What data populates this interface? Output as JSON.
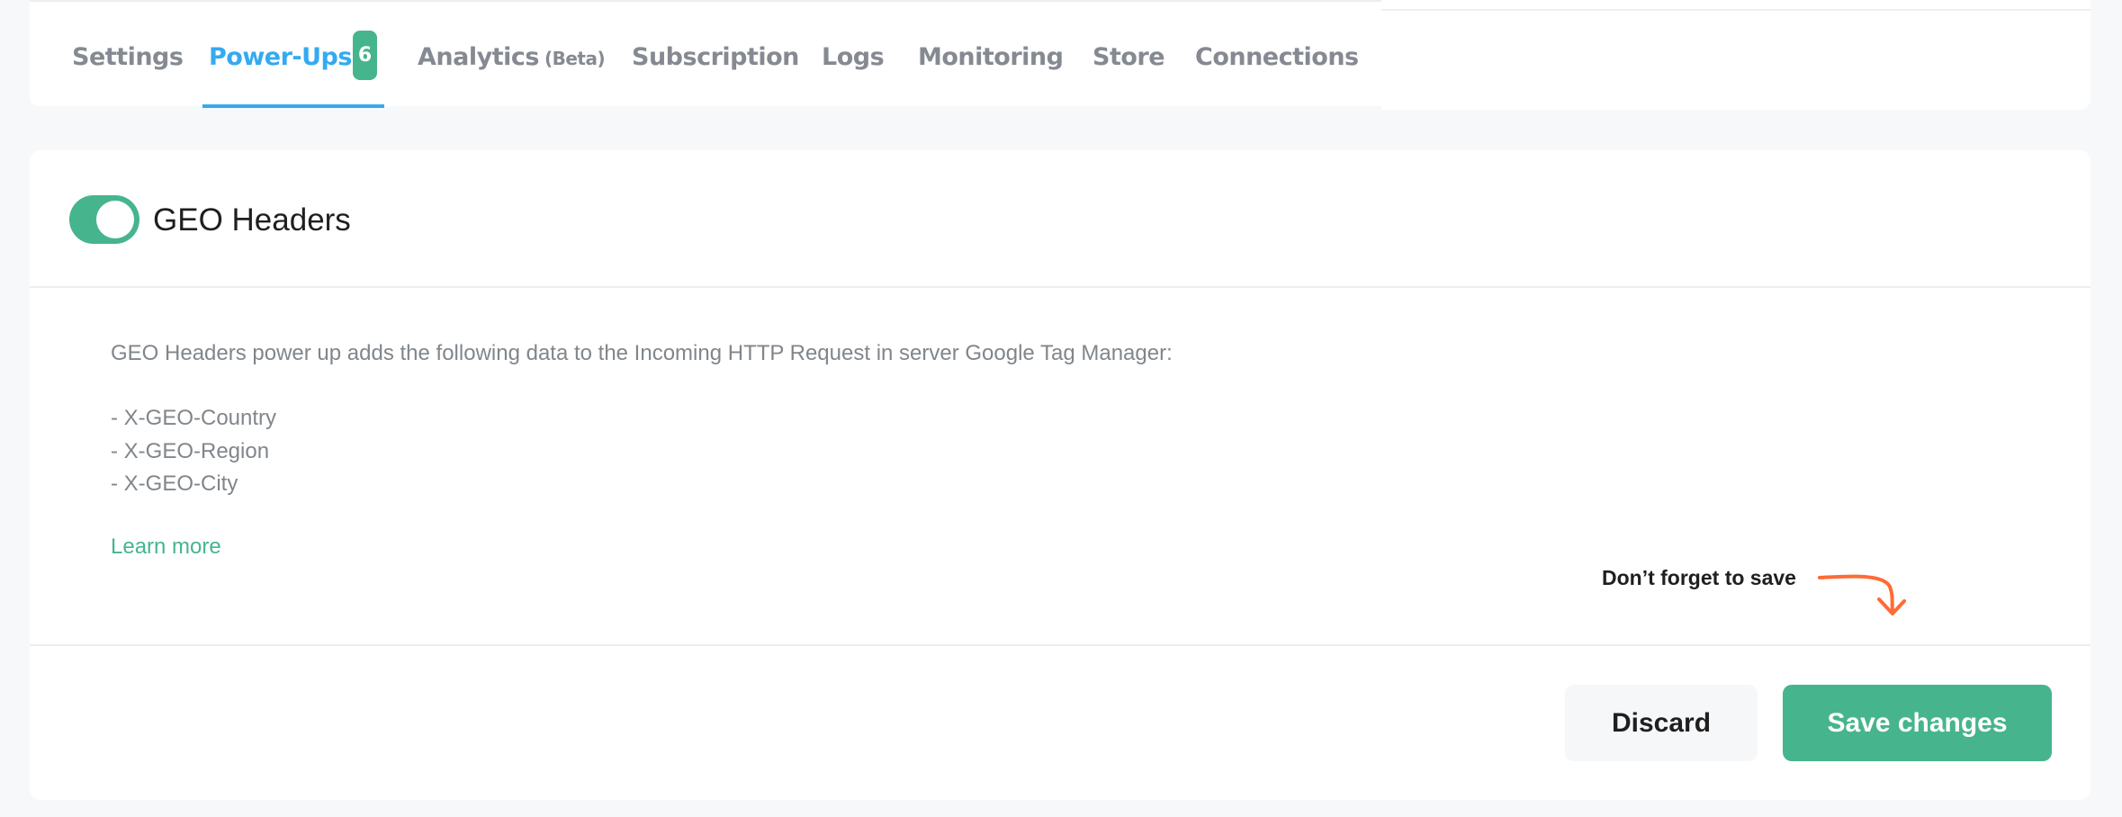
{
  "tabs": [
    {
      "label": "Settings",
      "active": false
    },
    {
      "label": "Power-Ups",
      "active": true,
      "badge": "6"
    },
    {
      "label": "Analytics",
      "suffix": "(Beta)",
      "active": false
    },
    {
      "label": "Subscription",
      "active": false
    },
    {
      "label": "Logs",
      "active": false
    },
    {
      "label": "Monitoring",
      "active": false
    },
    {
      "label": "Store",
      "active": false
    },
    {
      "label": "Connections",
      "active": false
    }
  ],
  "power_up": {
    "title": "GEO Headers",
    "enabled": true,
    "description": "GEO Headers power up adds the following data to the Incoming HTTP Request in server Google Tag Manager:",
    "headers": [
      "- X-GEO-Country",
      "- X-GEO-Region",
      "- X-GEO-City"
    ],
    "learn_more_label": "Learn more"
  },
  "reminder": {
    "text": "Don’t forget to save",
    "arrow_icon": "curved-arrow-down-icon"
  },
  "actions": {
    "discard_label": "Discard",
    "save_label": "Save changes"
  },
  "colors": {
    "accent_green": "#46b58d",
    "active_tab_blue": "#34aaf0",
    "reminder_orange": "#ff6b35",
    "muted_text": "#80868b"
  }
}
